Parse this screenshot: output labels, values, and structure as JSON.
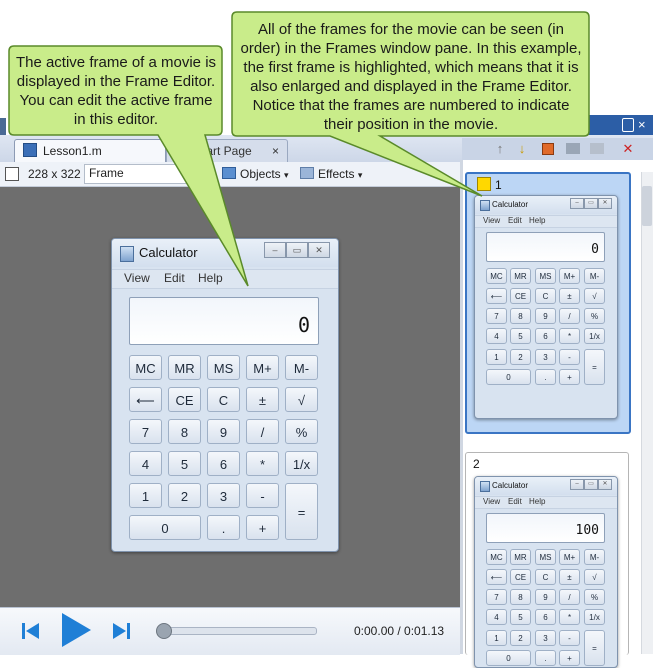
{
  "tabs": [
    {
      "label": "Lesson1.m"
    },
    {
      "label": "Start Page",
      "close": "×"
    }
  ],
  "editor_toolbar": {
    "dimensions": "228 x 322",
    "frame_label": "Frame",
    "objects_label": "Objects",
    "effects_label": "Effects"
  },
  "frames": [
    {
      "number": "1"
    },
    {
      "number": "2"
    }
  ],
  "calculator": {
    "title": "Calculator",
    "menu": [
      "View",
      "Edit",
      "Help"
    ],
    "keys": [
      "MC",
      "MR",
      "MS",
      "M+",
      "M-",
      "⟵",
      "CE",
      "C",
      "±",
      "√",
      "7",
      "8",
      "9",
      "/",
      "%",
      "4",
      "5",
      "6",
      "*",
      "1/x",
      "1",
      "2",
      "3",
      "-",
      "=",
      "0",
      ".",
      "+"
    ]
  },
  "calc_main": {
    "display": "0"
  },
  "calc_thumb1": {
    "display": "0"
  },
  "calc_thumb2": {
    "display": "100"
  },
  "playback": {
    "time": "0:00.00 / 0:01.13"
  },
  "callouts": {
    "left": "The active frame of a movie is displayed in the Frame Editor. You can edit the active frame in this editor.",
    "right": "All of the frames for the movie can be seen (in order) in the Frames window pane. In this example, the first frame is highlighted, which means that it is also enlarged and displayed in the Frame Editor. Notice that the frames are numbered to indicate their position in the movie."
  },
  "colors": {
    "callout_fill": "#c9ec8a",
    "callout_border": "#5a8a2a",
    "selection": "#3a75c4",
    "canvas": "#6e6e6e"
  }
}
